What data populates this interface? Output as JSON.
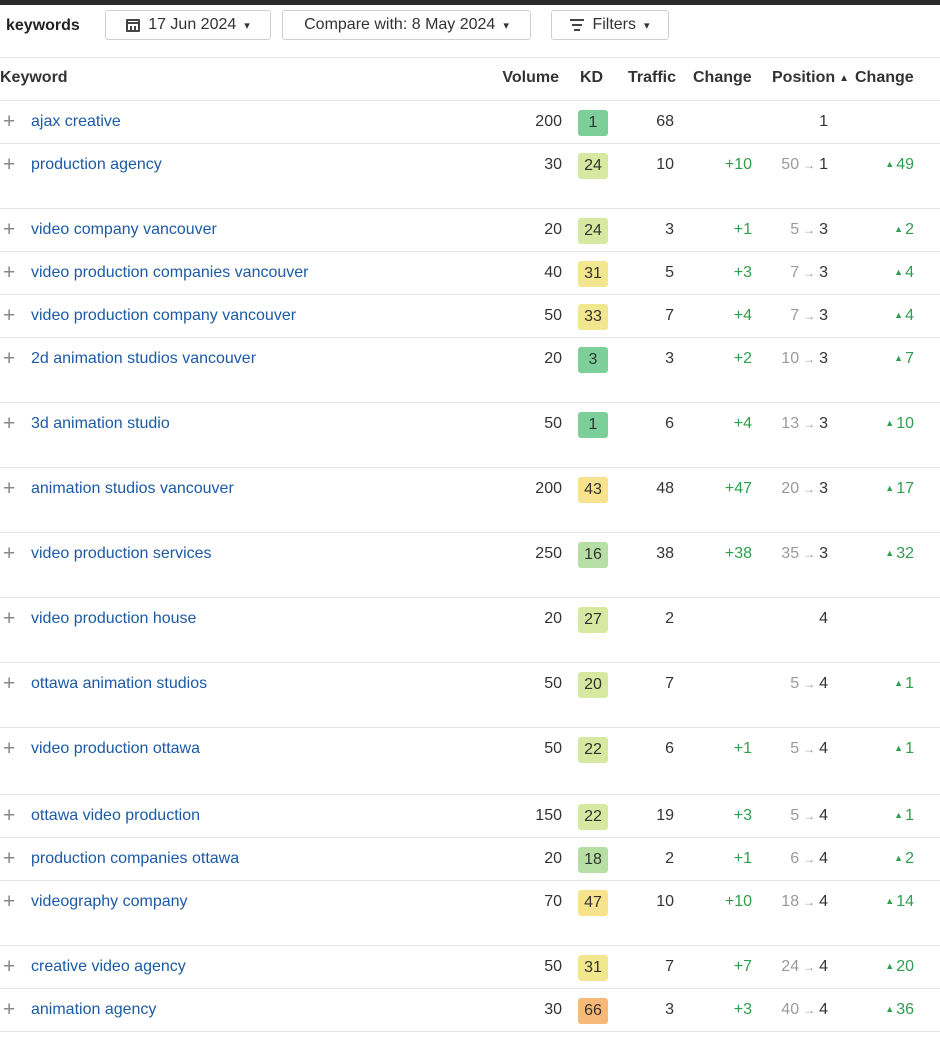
{
  "toolbar": {
    "title": "keywords",
    "date_label": "17 Jun 2024",
    "compare_label": "Compare with: 8 May 2024",
    "filters_label": "Filters",
    "calendar_icon": "calendar-icon",
    "filter_icon": "filter-icon",
    "caret": "▾"
  },
  "columns": {
    "keyword": "Keyword",
    "volume": "Volume",
    "kd": "KD",
    "traffic": "Traffic",
    "change": "Change",
    "position": "Position",
    "position_sort": "▲",
    "position_change": "Change"
  },
  "kd_colors": {
    "low": "#7dcf9a",
    "lowmid": "#b7dfa5",
    "mid": "#d7e8a0",
    "midhigh": "#f2e68e",
    "high": "#f7e38d",
    "hard": "#f7b978"
  },
  "rows": [
    {
      "keyword": "ajax creative",
      "volume": "200",
      "kd": "1",
      "kd_level": "low",
      "traffic": "68",
      "change": "",
      "from": "",
      "position": "1",
      "pos_change": ""
    },
    {
      "keyword": "production agency",
      "volume": "30",
      "kd": "24",
      "kd_level": "mid",
      "traffic": "10",
      "change": "+10",
      "from": "50",
      "position": "1",
      "pos_change": "49"
    },
    {
      "keyword": "video company vancouver",
      "volume": "20",
      "kd": "24",
      "kd_level": "mid",
      "traffic": "3",
      "change": "+1",
      "from": "5",
      "position": "3",
      "pos_change": "2"
    },
    {
      "keyword": "video production companies vancouver",
      "volume": "40",
      "kd": "31",
      "kd_level": "midhigh",
      "traffic": "5",
      "change": "+3",
      "from": "7",
      "position": "3",
      "pos_change": "4"
    },
    {
      "keyword": "video production company vancouver",
      "volume": "50",
      "kd": "33",
      "kd_level": "midhigh",
      "traffic": "7",
      "change": "+4",
      "from": "7",
      "position": "3",
      "pos_change": "4"
    },
    {
      "keyword": "2d animation studios vancouver",
      "volume": "20",
      "kd": "3",
      "kd_level": "low",
      "traffic": "3",
      "change": "+2",
      "from": "10",
      "position": "3",
      "pos_change": "7"
    },
    {
      "keyword": "3d animation studio",
      "volume": "50",
      "kd": "1",
      "kd_level": "low",
      "traffic": "6",
      "change": "+4",
      "from": "13",
      "position": "3",
      "pos_change": "10"
    },
    {
      "keyword": "animation studios vancouver",
      "volume": "200",
      "kd": "43",
      "kd_level": "high",
      "traffic": "48",
      "change": "+47",
      "from": "20",
      "position": "3",
      "pos_change": "17"
    },
    {
      "keyword": "video production services",
      "volume": "250",
      "kd": "16",
      "kd_level": "lowmid",
      "traffic": "38",
      "change": "+38",
      "from": "35",
      "position": "3",
      "pos_change": "32"
    },
    {
      "keyword": "video production house",
      "volume": "20",
      "kd": "27",
      "kd_level": "mid",
      "traffic": "2",
      "change": "",
      "from": "",
      "position": "4",
      "pos_change": ""
    },
    {
      "keyword": "ottawa animation studios",
      "volume": "50",
      "kd": "20",
      "kd_level": "mid",
      "traffic": "7",
      "change": "",
      "from": "5",
      "position": "4",
      "pos_change": "1"
    },
    {
      "keyword": "video production ottawa",
      "volume": "50",
      "kd": "22",
      "kd_level": "mid",
      "traffic": "6",
      "change": "+1",
      "from": "5",
      "position": "4",
      "pos_change": "1"
    },
    {
      "keyword": "ottawa video production",
      "volume": "150",
      "kd": "22",
      "kd_level": "mid",
      "traffic": "19",
      "change": "+3",
      "from": "5",
      "position": "4",
      "pos_change": "1"
    },
    {
      "keyword": "production companies ottawa",
      "volume": "20",
      "kd": "18",
      "kd_level": "lowmid",
      "traffic": "2",
      "change": "+1",
      "from": "6",
      "position": "4",
      "pos_change": "2"
    },
    {
      "keyword": "videography company",
      "volume": "70",
      "kd": "47",
      "kd_level": "high",
      "traffic": "10",
      "change": "+10",
      "from": "18",
      "position": "4",
      "pos_change": "14"
    },
    {
      "keyword": "creative video agency",
      "volume": "50",
      "kd": "31",
      "kd_level": "midhigh",
      "traffic": "7",
      "change": "+7",
      "from": "24",
      "position": "4",
      "pos_change": "20"
    },
    {
      "keyword": "animation agency",
      "volume": "30",
      "kd": "66",
      "kd_level": "hard",
      "traffic": "3",
      "change": "+3",
      "from": "40",
      "position": "4",
      "pos_change": "36"
    }
  ]
}
